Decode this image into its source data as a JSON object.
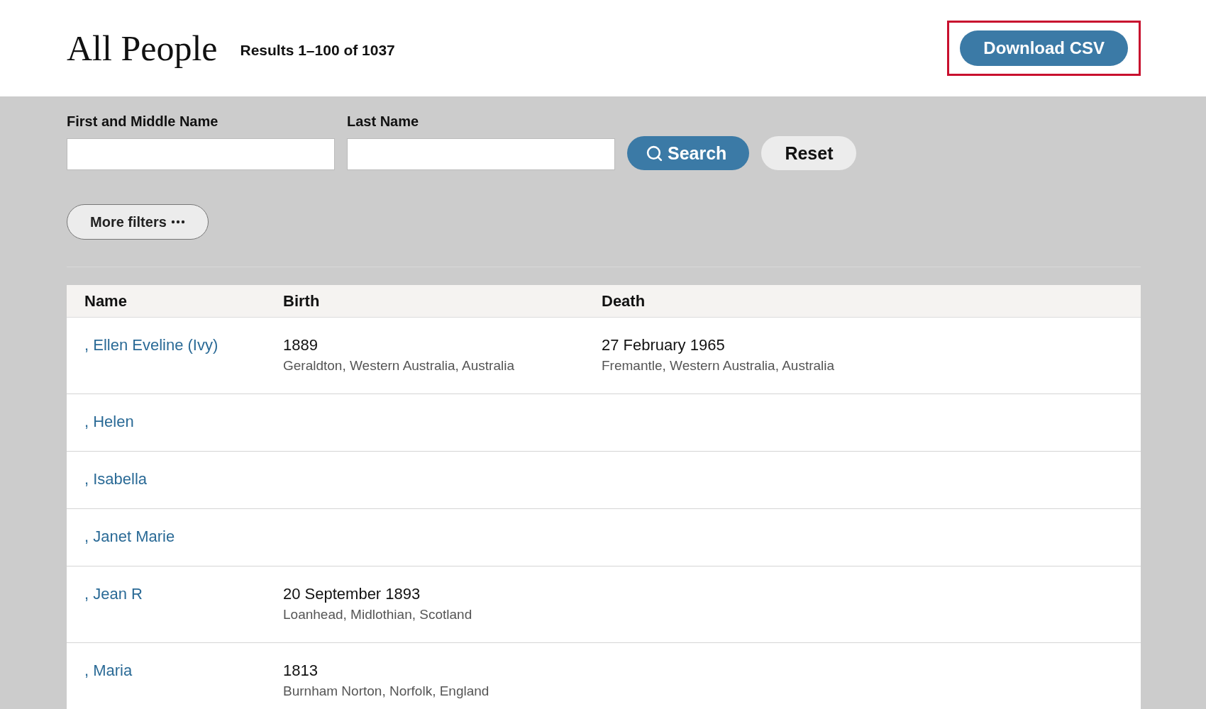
{
  "header": {
    "title": "All People",
    "results": "Results 1–100 of 1037",
    "download_button": "Download CSV",
    "download_highlighted": true
  },
  "filters": {
    "fields": [
      {
        "label": "First and Middle Name"
      },
      {
        "label": "Last Name"
      }
    ],
    "search_button": "Search",
    "reset_button": "Reset",
    "more_filters_button": "More filters"
  },
  "table": {
    "columns": [
      "Name",
      "Birth",
      "Death"
    ],
    "rows": [
      {
        "name": ", Ellen Eveline (Ivy)",
        "birth": {
          "date": "1889",
          "place": "Geraldton, Western Australia, Australia"
        },
        "death": {
          "date": "27 February 1965",
          "place": "Fremantle, Western Australia, Australia"
        }
      },
      {
        "name": ", Helen"
      },
      {
        "name": ", Isabella"
      },
      {
        "name": ", Janet Marie"
      },
      {
        "name": ", Jean R",
        "birth": {
          "date": "20 September 1893",
          "place": "Loanhead, Midlothian, Scotland"
        }
      },
      {
        "name": ", Maria",
        "birth": {
          "date": "1813",
          "place": "Burnham Norton, Norfolk, England"
        }
      }
    ]
  }
}
